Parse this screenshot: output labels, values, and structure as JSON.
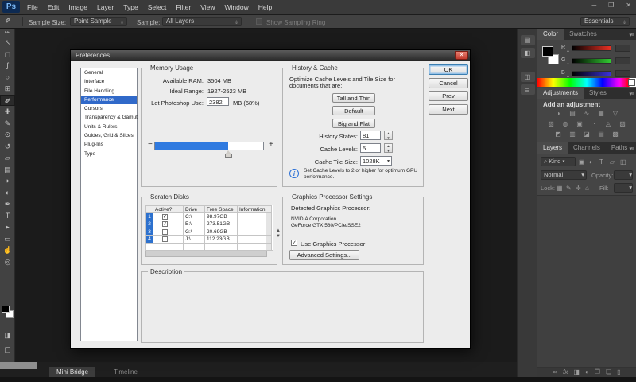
{
  "app": {
    "logo": "Ps",
    "menus": [
      "File",
      "Edit",
      "Image",
      "Layer",
      "Type",
      "Select",
      "Filter",
      "View",
      "Window",
      "Help"
    ],
    "window_buttons": [
      "minimize",
      "restore",
      "close"
    ]
  },
  "options_bar": {
    "sample_size_label": "Sample Size:",
    "sample_size_value": "Point Sample",
    "sample_label": "Sample:",
    "sample_value": "All Layers",
    "sampling_ring_label": "Show Sampling Ring",
    "workspace": "Essentials"
  },
  "toolbar": {
    "tools": [
      "move-tool",
      "marquee-tool",
      "lasso-tool",
      "quick-selection-tool",
      "crop-tool",
      "eyedropper-tool",
      "healing-brush-tool",
      "brush-tool",
      "clone-stamp-tool",
      "history-brush-tool",
      "eraser-tool",
      "gradient-tool",
      "blur-tool",
      "dodge-tool",
      "pen-tool",
      "type-tool",
      "path-selection-tool",
      "shape-tool",
      "hand-tool",
      "zoom-tool"
    ],
    "active_tool": "eyedropper-tool"
  },
  "panels": {
    "color": {
      "tabs": [
        "Color",
        "Swatches"
      ],
      "sliders": [
        "R",
        "G",
        "B"
      ]
    },
    "adjustments": {
      "tabs": [
        "Adjustments",
        "Styles"
      ],
      "heading": "Add an adjustment"
    },
    "layers": {
      "tabs": [
        "Layers",
        "Channels",
        "Paths"
      ],
      "filter_label": "Kind",
      "blend_mode": "Normal",
      "opacity_label": "Opacity:",
      "lock_label": "Lock:",
      "fill_label": "Fill:"
    }
  },
  "bottom_tabs": {
    "active": "Mini Bridge",
    "inactive": "Timeline"
  },
  "dialog": {
    "title": "Preferences",
    "categories": [
      "General",
      "Interface",
      "File Handling",
      "Performance",
      "Cursors",
      "Transparency & Gamut",
      "Units & Rulers",
      "Guides, Grid & Slices",
      "Plug-Ins",
      "Type"
    ],
    "selected_category": "Performance",
    "buttons": [
      "OK",
      "Cancel",
      "Prev",
      "Next"
    ],
    "memory": {
      "legend": "Memory Usage",
      "available_label": "Available RAM:",
      "available_value": "3504 MB",
      "ideal_label": "Ideal Range:",
      "ideal_value": "1927-2523 MB",
      "use_label": "Let Photoshop Use:",
      "use_value": "2382",
      "use_suffix": "MB (68%)",
      "slider_percent": 68
    },
    "history": {
      "legend": "History & Cache",
      "intro_line1": "Optimize Cache Levels and Tile Size for",
      "intro_line2": "documents that are:",
      "preset_buttons": [
        "Tall and Thin",
        "Default",
        "Big and Flat"
      ],
      "history_states_label": "History States:",
      "history_states_value": "81",
      "cache_levels_label": "Cache Levels:",
      "cache_levels_value": "5",
      "cache_tile_label": "Cache Tile Size:",
      "cache_tile_value": "1028K",
      "note_line1": "Set Cache Levels to 2 or higher for optimum GPU",
      "note_line2": "performance."
    },
    "scratch": {
      "legend": "Scratch Disks",
      "columns": [
        "Active?",
        "Drive",
        "Free Space",
        "Information"
      ],
      "rows": [
        {
          "num": "1",
          "active": true,
          "drive": "C:\\",
          "free": "98.97GB",
          "info": ""
        },
        {
          "num": "2",
          "active": true,
          "drive": "E:\\",
          "free": "273.51GB",
          "info": ""
        },
        {
          "num": "3",
          "active": false,
          "drive": "G:\\",
          "free": "20.69GB",
          "info": ""
        },
        {
          "num": "4",
          "active": false,
          "drive": "J:\\",
          "free": "112.23GB",
          "info": ""
        }
      ]
    },
    "gpu": {
      "legend": "Graphics Processor Settings",
      "detected_label": "Detected Graphics Processor:",
      "vendor": "NVIDIA Corporation",
      "model": "GeForce GTX 580/PCIe/SSE2",
      "use_label": "Use Graphics Processor",
      "use_checked": true,
      "advanced_button": "Advanced Settings..."
    },
    "description": {
      "legend": "Description"
    }
  }
}
